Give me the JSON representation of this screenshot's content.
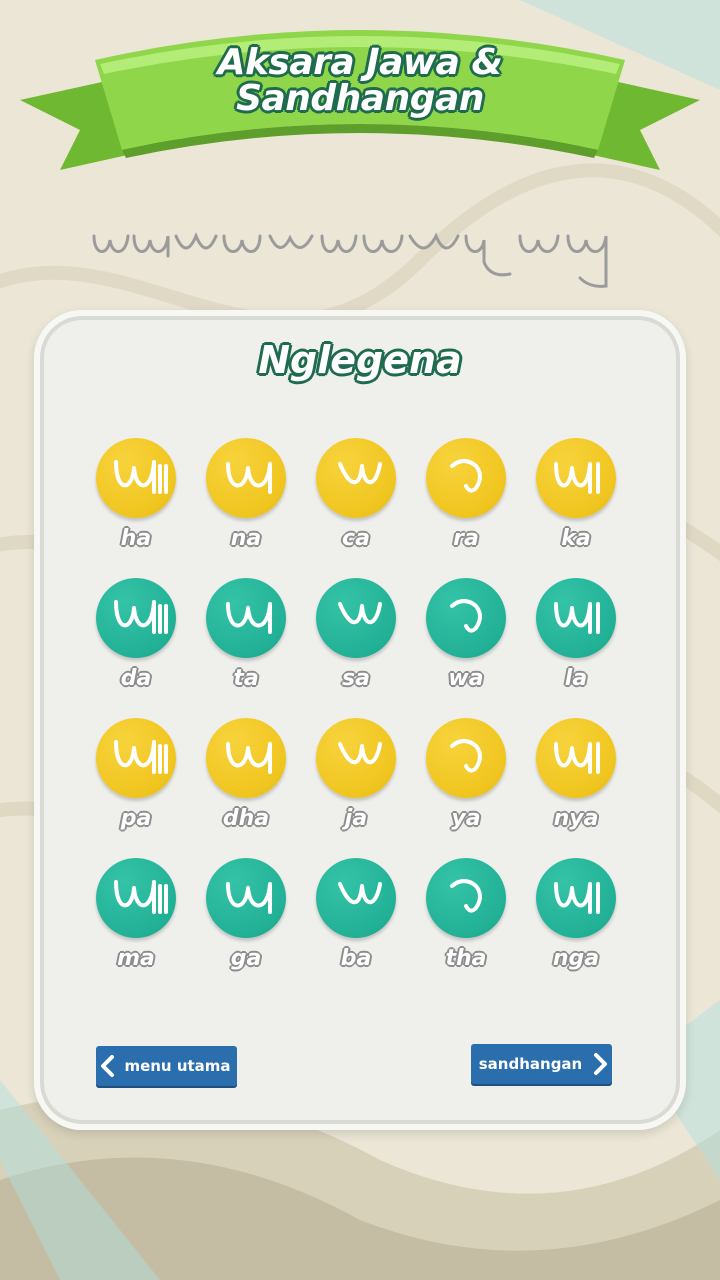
{
  "header": {
    "title_line1": "Aksara Jawa &",
    "title_line2": "Sandhangan"
  },
  "section": {
    "title": "Nglegena"
  },
  "letters": [
    {
      "label": "ha",
      "color": "yellow"
    },
    {
      "label": "na",
      "color": "yellow"
    },
    {
      "label": "ca",
      "color": "yellow"
    },
    {
      "label": "ra",
      "color": "yellow"
    },
    {
      "label": "ka",
      "color": "yellow"
    },
    {
      "label": "da",
      "color": "teal"
    },
    {
      "label": "ta",
      "color": "teal"
    },
    {
      "label": "sa",
      "color": "teal"
    },
    {
      "label": "wa",
      "color": "teal"
    },
    {
      "label": "la",
      "color": "teal"
    },
    {
      "label": "pa",
      "color": "yellow"
    },
    {
      "label": "dha",
      "color": "yellow"
    },
    {
      "label": "ja",
      "color": "yellow"
    },
    {
      "label": "ya",
      "color": "yellow"
    },
    {
      "label": "nya",
      "color": "yellow"
    },
    {
      "label": "ma",
      "color": "teal"
    },
    {
      "label": "ga",
      "color": "teal"
    },
    {
      "label": "ba",
      "color": "teal"
    },
    {
      "label": "tha",
      "color": "teal"
    },
    {
      "label": "nga",
      "color": "teal"
    }
  ],
  "nav": {
    "back_label": "menu utama",
    "next_label": "sandhangan",
    "back_icon": "chevron-left-icon",
    "next_icon": "chevron-right-icon"
  },
  "colors": {
    "banner_green": "#8fd64a",
    "title_outline": "#1f6b4f",
    "yellow": "#f0c51f",
    "teal": "#22b196",
    "button_blue": "#2b6eae"
  }
}
